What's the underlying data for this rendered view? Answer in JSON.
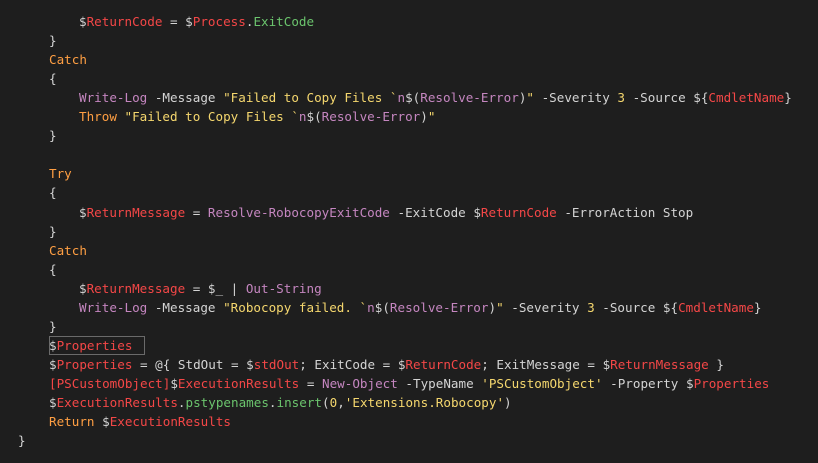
{
  "colors": {
    "background": "#1e1e1e",
    "text": "#d4d4d4",
    "variable_sigil": "#d4d4d4",
    "variable": "#f44747",
    "keyword": "#ff9f43",
    "string": "#f5d76e",
    "command": "#c586c0",
    "number": "#f5d76e",
    "property": "#6bc46d",
    "escape": "#c586c0"
  },
  "selection_box": {
    "line_index": 17
  },
  "lines": [
    {
      "indent": 2,
      "tokens": [
        {
          "t": "$",
          "c": "variable_sigil"
        },
        {
          "t": "ReturnCode",
          "c": "variable"
        },
        {
          "t": " = ",
          "c": "text"
        },
        {
          "t": "$",
          "c": "variable_sigil"
        },
        {
          "t": "Process",
          "c": "variable"
        },
        {
          "t": ".",
          "c": "text"
        },
        {
          "t": "ExitCode",
          "c": "property"
        }
      ]
    },
    {
      "indent": 1,
      "tokens": [
        {
          "t": "}",
          "c": "text"
        }
      ]
    },
    {
      "indent": 1,
      "tokens": [
        {
          "t": "Catch",
          "c": "keyword"
        }
      ]
    },
    {
      "indent": 1,
      "tokens": [
        {
          "t": "{",
          "c": "text"
        }
      ]
    },
    {
      "indent": 2,
      "tokens": [
        {
          "t": "Write-Log",
          "c": "command"
        },
        {
          "t": " -Message ",
          "c": "text"
        },
        {
          "t": "\"Failed to Copy Files `",
          "c": "string"
        },
        {
          "t": "n",
          "c": "escape"
        },
        {
          "t": "$(",
          "c": "text"
        },
        {
          "t": "Resolve-Error",
          "c": "command"
        },
        {
          "t": ")",
          "c": "text"
        },
        {
          "t": "\"",
          "c": "string"
        },
        {
          "t": " -Severity ",
          "c": "text"
        },
        {
          "t": "3",
          "c": "number"
        },
        {
          "t": " -Source ",
          "c": "text"
        },
        {
          "t": "${",
          "c": "text"
        },
        {
          "t": "CmdletName",
          "c": "variable"
        },
        {
          "t": "}",
          "c": "text"
        }
      ]
    },
    {
      "indent": 2,
      "tokens": [
        {
          "t": "Throw",
          "c": "keyword"
        },
        {
          "t": " ",
          "c": "text"
        },
        {
          "t": "\"Failed to Copy Files `",
          "c": "string"
        },
        {
          "t": "n",
          "c": "escape"
        },
        {
          "t": "$(",
          "c": "text"
        },
        {
          "t": "Resolve-Error",
          "c": "command"
        },
        {
          "t": ")",
          "c": "text"
        },
        {
          "t": "\"",
          "c": "string"
        }
      ]
    },
    {
      "indent": 1,
      "tokens": [
        {
          "t": "}",
          "c": "text"
        }
      ]
    },
    {
      "indent": 0,
      "tokens": []
    },
    {
      "indent": 1,
      "tokens": [
        {
          "t": "Try",
          "c": "keyword"
        }
      ]
    },
    {
      "indent": 1,
      "tokens": [
        {
          "t": "{",
          "c": "text"
        }
      ]
    },
    {
      "indent": 2,
      "tokens": [
        {
          "t": "$",
          "c": "variable_sigil"
        },
        {
          "t": "ReturnMessage",
          "c": "variable"
        },
        {
          "t": " = ",
          "c": "text"
        },
        {
          "t": "Resolve-RobocopyExitCode",
          "c": "command"
        },
        {
          "t": " -ExitCode ",
          "c": "text"
        },
        {
          "t": "$",
          "c": "variable_sigil"
        },
        {
          "t": "ReturnCode",
          "c": "variable"
        },
        {
          "t": " -ErrorAction Stop",
          "c": "text"
        }
      ]
    },
    {
      "indent": 1,
      "tokens": [
        {
          "t": "}",
          "c": "text"
        }
      ]
    },
    {
      "indent": 1,
      "tokens": [
        {
          "t": "Catch",
          "c": "keyword"
        }
      ]
    },
    {
      "indent": 1,
      "tokens": [
        {
          "t": "{",
          "c": "text"
        }
      ]
    },
    {
      "indent": 2,
      "tokens": [
        {
          "t": "$",
          "c": "variable_sigil"
        },
        {
          "t": "ReturnMessage",
          "c": "variable"
        },
        {
          "t": " = ",
          "c": "text"
        },
        {
          "t": "$_",
          "c": "text"
        },
        {
          "t": " | ",
          "c": "text"
        },
        {
          "t": "Out-String",
          "c": "command"
        }
      ]
    },
    {
      "indent": 2,
      "tokens": [
        {
          "t": "Write-Log",
          "c": "command"
        },
        {
          "t": " -Message ",
          "c": "text"
        },
        {
          "t": "\"Robocopy failed. `",
          "c": "string"
        },
        {
          "t": "n",
          "c": "escape"
        },
        {
          "t": "$(",
          "c": "text"
        },
        {
          "t": "Resolve-Error",
          "c": "command"
        },
        {
          "t": ")",
          "c": "text"
        },
        {
          "t": "\"",
          "c": "string"
        },
        {
          "t": " -Severity ",
          "c": "text"
        },
        {
          "t": "3",
          "c": "number"
        },
        {
          "t": " -Source ",
          "c": "text"
        },
        {
          "t": "${",
          "c": "text"
        },
        {
          "t": "CmdletName",
          "c": "variable"
        },
        {
          "t": "}",
          "c": "text"
        }
      ]
    },
    {
      "indent": 1,
      "tokens": [
        {
          "t": "}",
          "c": "text"
        }
      ]
    },
    {
      "indent": 1,
      "tokens": [
        {
          "t": "$",
          "c": "variable_sigil"
        },
        {
          "t": "Properties",
          "c": "variable"
        }
      ]
    },
    {
      "indent": 1,
      "tokens": [
        {
          "t": "$",
          "c": "variable_sigil"
        },
        {
          "t": "Properties",
          "c": "variable"
        },
        {
          "t": " = @{ StdOut = ",
          "c": "text"
        },
        {
          "t": "$",
          "c": "variable_sigil"
        },
        {
          "t": "stdOut",
          "c": "variable"
        },
        {
          "t": "; ExitCode = ",
          "c": "text"
        },
        {
          "t": "$",
          "c": "variable_sigil"
        },
        {
          "t": "ReturnCode",
          "c": "variable"
        },
        {
          "t": "; ExitMessage = ",
          "c": "text"
        },
        {
          "t": "$",
          "c": "variable_sigil"
        },
        {
          "t": "ReturnMessage",
          "c": "variable"
        },
        {
          "t": " }",
          "c": "text"
        }
      ]
    },
    {
      "indent": 1,
      "tokens": [
        {
          "t": "[PSCustomObject]",
          "c": "variable"
        },
        {
          "t": "$",
          "c": "variable_sigil"
        },
        {
          "t": "ExecutionResults",
          "c": "variable"
        },
        {
          "t": " = ",
          "c": "text"
        },
        {
          "t": "New-Object",
          "c": "command"
        },
        {
          "t": " -TypeName ",
          "c": "text"
        },
        {
          "t": "'PSCustomObject'",
          "c": "string"
        },
        {
          "t": " -Property ",
          "c": "text"
        },
        {
          "t": "$",
          "c": "variable_sigil"
        },
        {
          "t": "Properties",
          "c": "variable"
        }
      ]
    },
    {
      "indent": 1,
      "tokens": [
        {
          "t": "$",
          "c": "variable_sigil"
        },
        {
          "t": "ExecutionResults",
          "c": "variable"
        },
        {
          "t": ".",
          "c": "text"
        },
        {
          "t": "pstypenames",
          "c": "property"
        },
        {
          "t": ".",
          "c": "text"
        },
        {
          "t": "insert",
          "c": "property"
        },
        {
          "t": "(",
          "c": "text"
        },
        {
          "t": "0",
          "c": "number"
        },
        {
          "t": ",",
          "c": "text"
        },
        {
          "t": "'Extensions.Robocopy'",
          "c": "string"
        },
        {
          "t": ")",
          "c": "text"
        }
      ]
    },
    {
      "indent": 1,
      "tokens": [
        {
          "t": "Return",
          "c": "keyword"
        },
        {
          "t": " ",
          "c": "text"
        },
        {
          "t": "$",
          "c": "variable_sigil"
        },
        {
          "t": "ExecutionResults",
          "c": "variable"
        }
      ]
    },
    {
      "indent": 0,
      "tokens": [
        {
          "t": "}",
          "c": "text"
        }
      ]
    }
  ]
}
